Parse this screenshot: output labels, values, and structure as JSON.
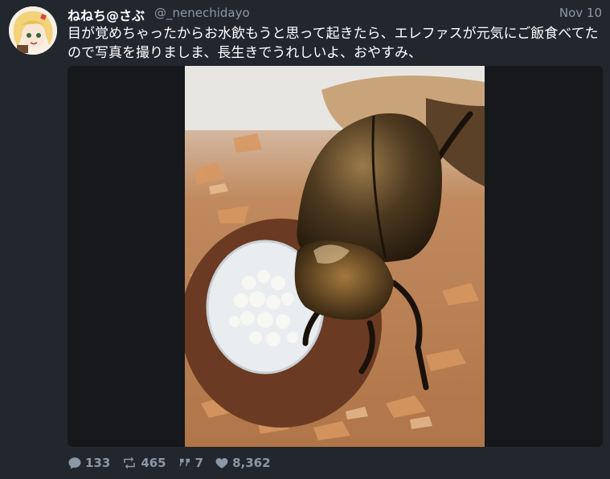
{
  "tweet": {
    "display_name": "ねねち@さぶ",
    "handle": "@_nenechidayo",
    "date": "Nov 10",
    "text": "目が覚めちゃったからお水飲もうと思って起きたら、エレファスが元気にご飯食べてたので写真を撮りましま、長生きでうれしいよ、おやすみ、"
  },
  "media": {
    "photo_icon": "beetle-photo"
  },
  "stats": {
    "replies": "133",
    "retweets": "465",
    "quotes": "7",
    "likes": "8,362"
  },
  "icons": {
    "reply": "reply-icon",
    "retweet": "retweet-icon",
    "quote": "quote-icon",
    "like": "heart-icon"
  },
  "colors": {
    "background": "#22272e",
    "muted": "#8b98a5",
    "text": "#ffffff"
  }
}
